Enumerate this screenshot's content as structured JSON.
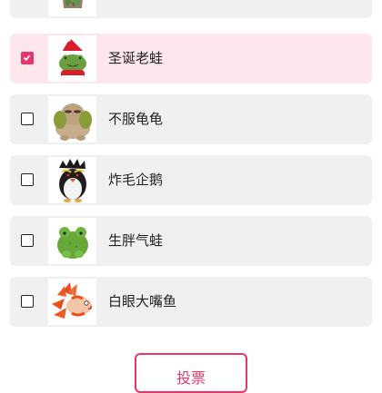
{
  "colors": {
    "accent": "#e8356a",
    "selected_bg": "#fde6ec",
    "item_bg": "#f0f0f0"
  },
  "items": [
    {
      "label": "",
      "image": "potted-plant-plush",
      "checked": false
    },
    {
      "label": "圣诞老蛙",
      "image": "christmas-frog-plush",
      "checked": true
    },
    {
      "label": "不服龟龟",
      "image": "turtle-plush",
      "checked": false
    },
    {
      "label": "炸毛企鹅",
      "image": "rockhopper-penguin-plush",
      "checked": false
    },
    {
      "label": "生胖气蛙",
      "image": "green-frog-plush",
      "checked": false
    },
    {
      "label": "白眼大嘴鱼",
      "image": "lionfish-plush",
      "checked": false
    }
  ],
  "vote_button": {
    "label": "投票"
  }
}
